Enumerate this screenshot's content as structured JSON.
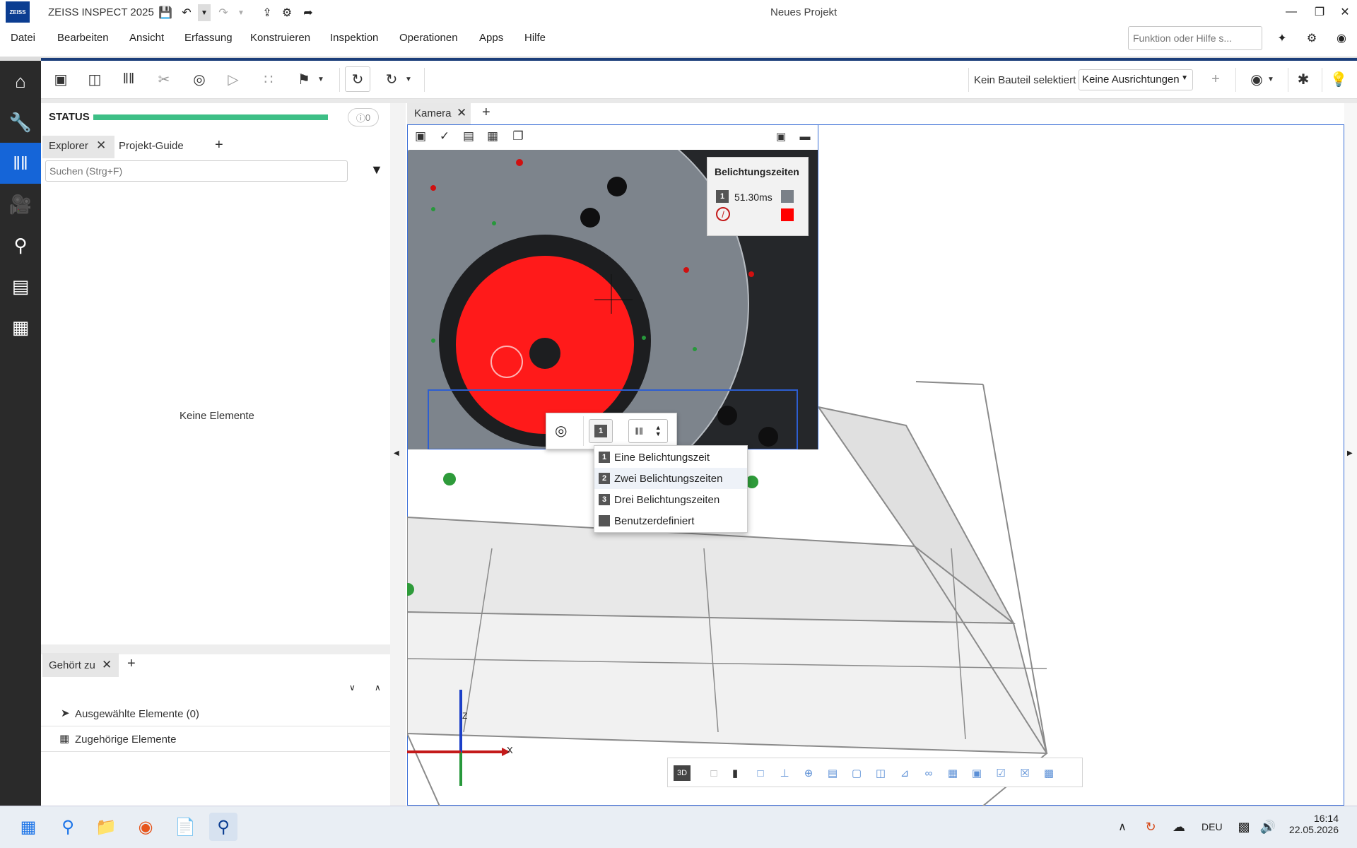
{
  "app": {
    "title": "ZEISS INSPECT 2025",
    "logo_text": "ZEISS",
    "project": "Neues Projekt"
  },
  "menu": [
    "Datei",
    "Bearbeiten",
    "Ansicht",
    "Erfassung",
    "Konstruieren",
    "Inspektion",
    "Operationen",
    "Apps",
    "Hilfe"
  ],
  "function_search": {
    "placeholder": "Funktion oder Hilfe s..."
  },
  "toolbar": {
    "part_status": "Kein Bauteil selektiert",
    "alignment_select": "Keine Ausrichtungen"
  },
  "status": {
    "label": "STATUS",
    "info_count": "0",
    "progress": 1.0,
    "color": "#3dbf86"
  },
  "explorer": {
    "tabs": [
      "Explorer",
      "Projekt-Guide"
    ],
    "search_placeholder": "Suchen (Strg+F)",
    "empty_text": "Keine Elemente"
  },
  "belongs": {
    "tab": "Gehört zu",
    "rows": [
      "Ausgewählte Elemente (0)",
      "Zugehörige Elemente"
    ]
  },
  "camera": {
    "tab": "Kamera",
    "exposure_panel": {
      "title": "Belichtungszeiten",
      "value": "51.30ms"
    },
    "exposure_menu": [
      {
        "num": "1",
        "label": "Eine Belichtungszeit"
      },
      {
        "num": "2",
        "label": "Zwei Belichtungszeiten"
      },
      {
        "num": "3",
        "label": "Drei Belichtungszeiten"
      },
      {
        "num": "",
        "label": "Benutzerdefiniert"
      }
    ]
  },
  "axes": {
    "x": "X",
    "z": "Z"
  },
  "bottom_tools": {
    "view_3d": "3D"
  },
  "taskbar": {
    "language": "DEU",
    "time": "16:14",
    "date": "22.05.2026"
  }
}
